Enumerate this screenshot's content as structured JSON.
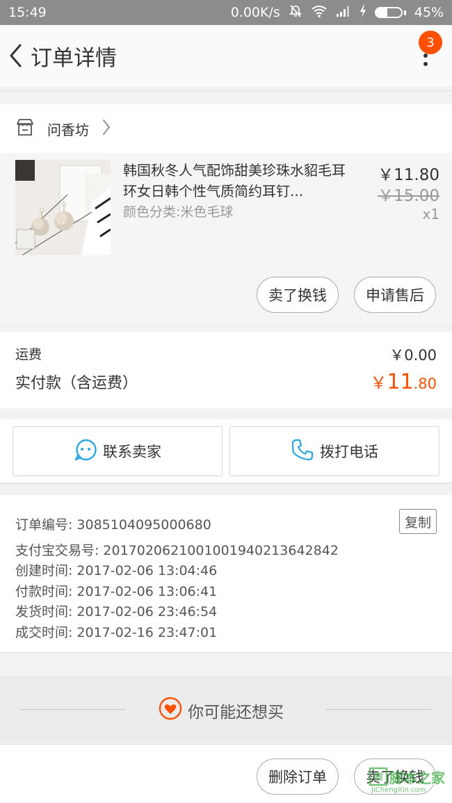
{
  "status_bar": {
    "time": "15:49",
    "network_speed": "0.00K/s",
    "battery": "45%",
    "battery_level": 0.45
  },
  "nav": {
    "title": "订单详情",
    "badge_count": "3"
  },
  "shop": {
    "name": "问香坊"
  },
  "item": {
    "title": "韩国秋冬人气配饰甜美珍珠水貂毛耳环女日韩个性气质简约耳钉...",
    "sku": "颜色分类:米色毛球",
    "price": "￥11.80",
    "original_price": "￥15.00",
    "quantity": "x1",
    "sell_label": "卖了换钱",
    "aftersale_label": "申请售后"
  },
  "fees": {
    "shipping_label": "运费",
    "shipping_value": "￥0.00",
    "paid_label": "实付款（含运费）",
    "paid_yen": "￥",
    "paid_int": "11",
    "paid_dec": ".80"
  },
  "contact": {
    "seller_label": "联系卖家",
    "phone_label": "拨打电话"
  },
  "order_info": {
    "copy_label": "复制",
    "rows": [
      {
        "label": "订单编号:",
        "value": "3085104095000680"
      },
      {
        "label": "支付宝交易号:",
        "value": "2017020621001001940213642842"
      },
      {
        "label": "创建时间:",
        "value": "2017-02-06 13:04:46"
      },
      {
        "label": "付款时间:",
        "value": "2017-02-06 13:06:41"
      },
      {
        "label": "发货时间:",
        "value": "2017-02-06 23:46:54"
      },
      {
        "label": "成交时间:",
        "value": "2017-02-16 23:47:01"
      }
    ]
  },
  "recommend": {
    "title": "你可能还想买"
  },
  "bottom": {
    "delete_label": "删除订单",
    "sell_label": "卖了换钱"
  },
  "watermark": {
    "text": "脚本之家",
    "sub": "JiChengXin.com"
  },
  "colors": {
    "accent": "#ff5000",
    "icon_blue": "#2aa6e6",
    "status_bar": "#8c8c8c"
  }
}
